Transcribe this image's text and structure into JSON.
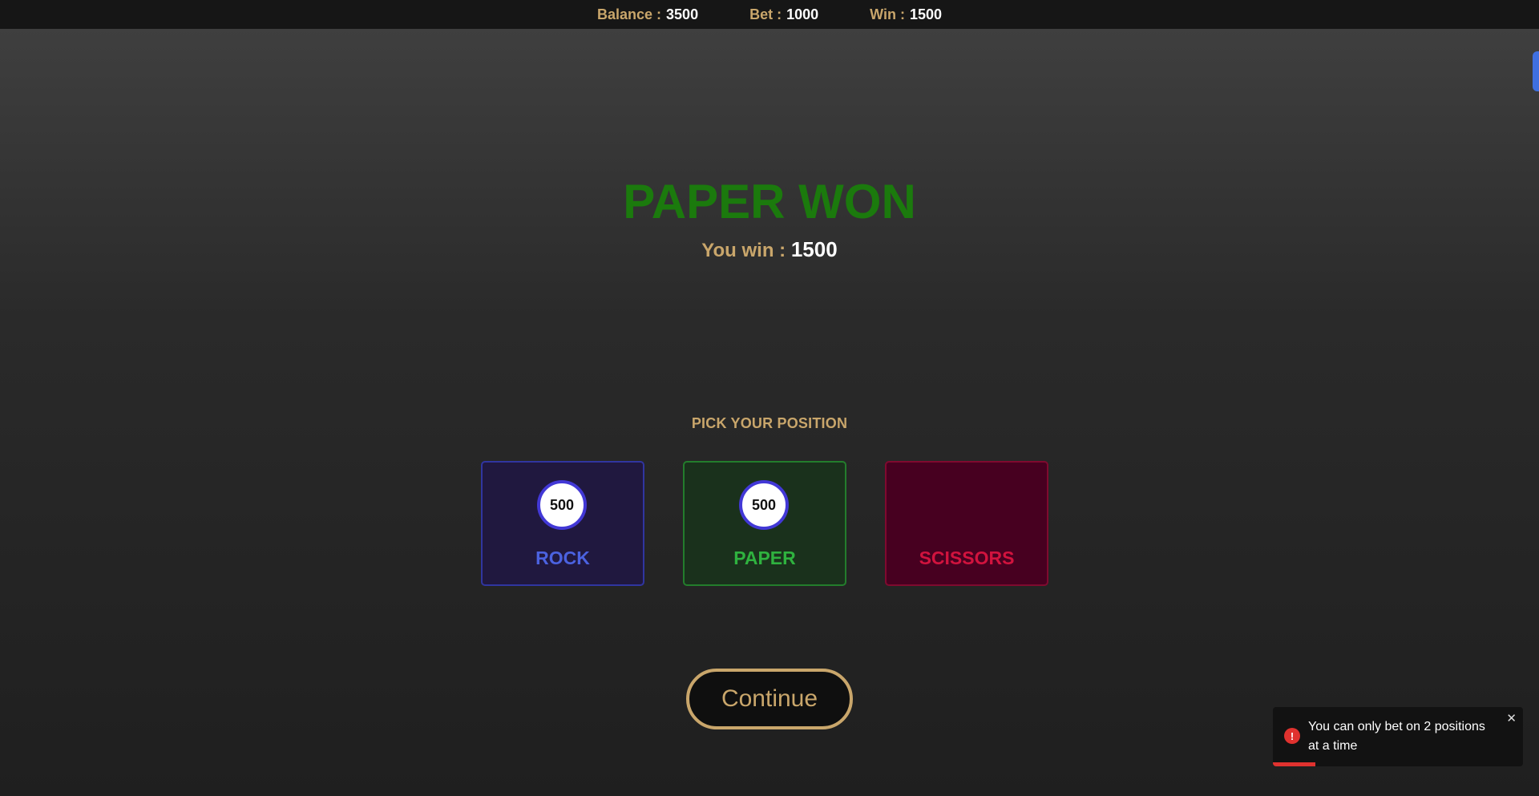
{
  "header": {
    "balance_label": "Balance :",
    "balance_value": "3500",
    "bet_label": "Bet :",
    "bet_value": "1000",
    "win_label": "Win :",
    "win_value": "1500"
  },
  "result": {
    "title": "PAPER WON",
    "win_label": "You win :",
    "win_value": "1500"
  },
  "pick_heading": "PICK YOUR POSITION",
  "positions": [
    {
      "label": "ROCK",
      "chip": "500"
    },
    {
      "label": "PAPER",
      "chip": "500"
    },
    {
      "label": "SCISSORS",
      "chip": null
    }
  ],
  "continue_label": "Continue",
  "toast": {
    "icon": "error-icon",
    "message": "You can only bet on 2 positions at a time",
    "close_icon": "close-icon",
    "progress": 0.17
  },
  "colors": {
    "accent_gold": "#c9a66b",
    "win_green": "#1b7a0d",
    "rock": "#4b62e0",
    "paper": "#2fb23f",
    "scissors": "#d1133e",
    "error": "#e0322f"
  }
}
